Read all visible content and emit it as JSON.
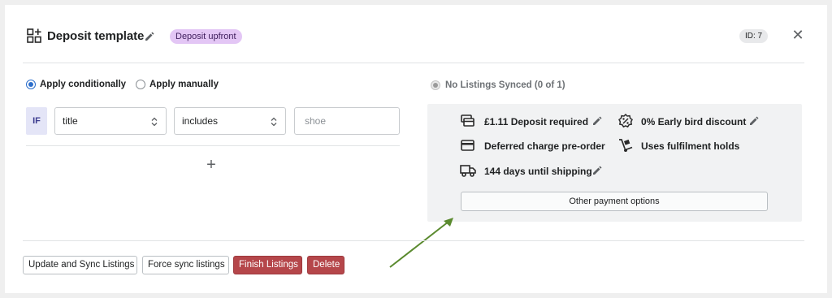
{
  "header": {
    "title": "Deposit template",
    "badge": "Deposit upfront",
    "id_badge": "ID: 7"
  },
  "apply": {
    "conditional_label": "Apply conditionally",
    "manual_label": "Apply manually",
    "selected": "conditional"
  },
  "condition": {
    "if_label": "IF",
    "field_value": "title",
    "operator_value": "includes",
    "value_placeholder": "shoe"
  },
  "sync": {
    "status": "No Listings Synced (0 of 1)"
  },
  "features": {
    "deposit": "£1.11 Deposit required",
    "early_bird": "0% Early bird discount",
    "deferred": "Deferred charge pre-order",
    "holds": "Uses fulfilment holds",
    "shipping": "144 days until shipping",
    "other_button": "Other payment options"
  },
  "footer": {
    "update_sync": "Update and Sync Listings",
    "force_sync": "Force sync listings",
    "finish": "Finish Listings",
    "delete": "Delete"
  },
  "colors": {
    "accent": "#2c6ecb",
    "badge_bg": "#e3c6f5",
    "danger": "#b5464a",
    "arrow": "#5a8a2e"
  },
  "icons": {
    "template": "template-grid-icon",
    "edit": "pencil-icon",
    "close": "close-icon",
    "deposit": "cards-icon",
    "discount": "percent-badge-icon",
    "deferred": "credit-card-icon",
    "holds": "hand-truck-icon",
    "shipping": "truck-icon"
  }
}
